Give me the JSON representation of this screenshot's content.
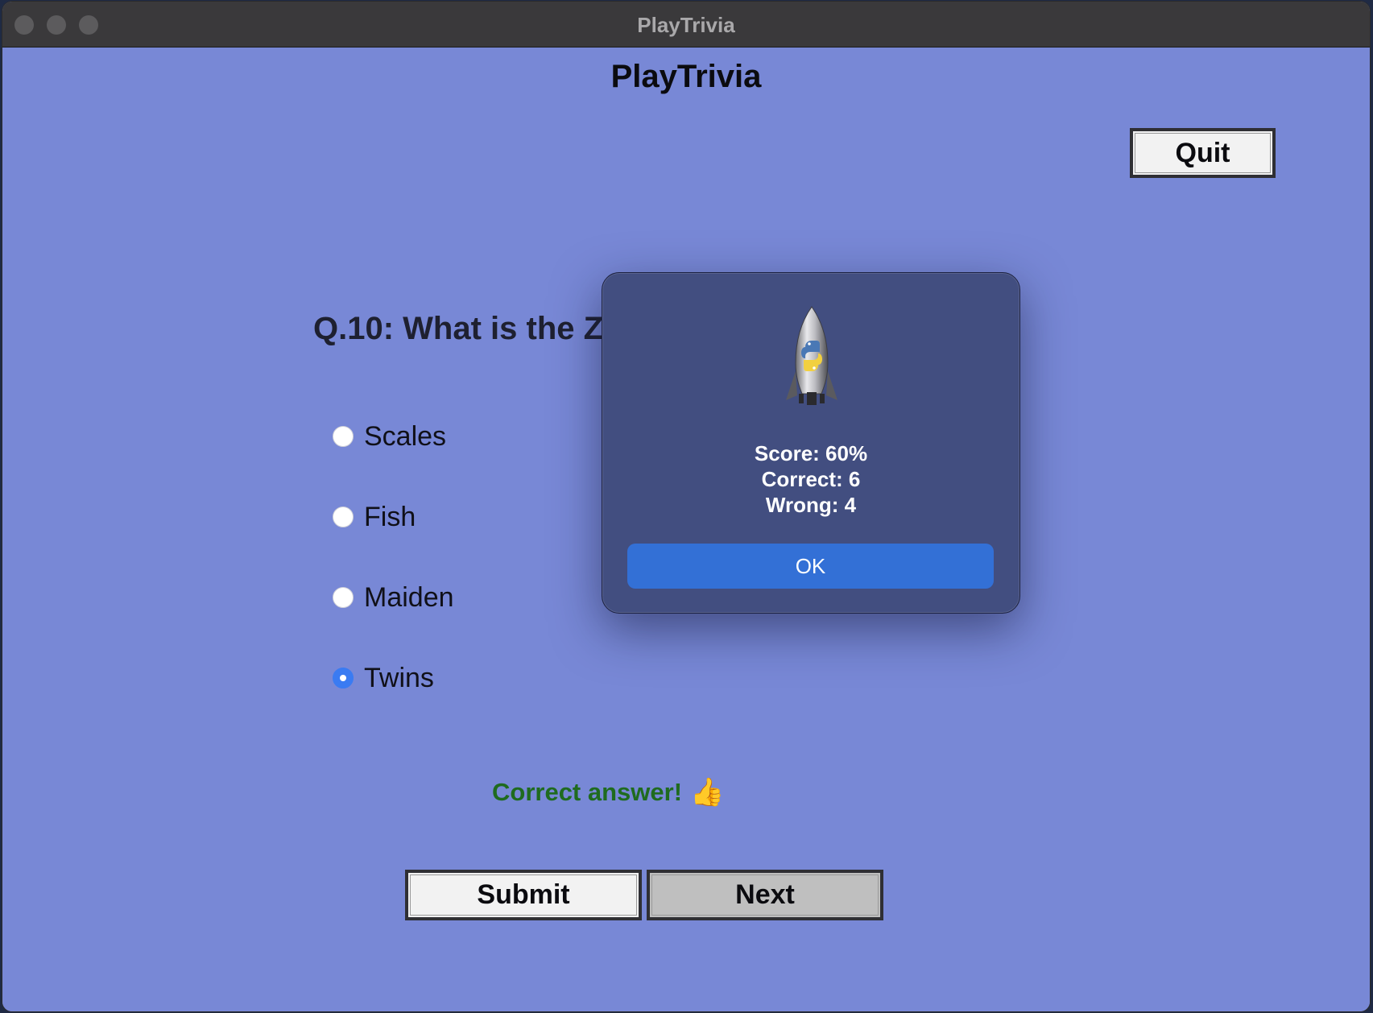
{
  "window": {
    "title": "PlayTrivia"
  },
  "app": {
    "heading": "PlayTrivia",
    "quit_label": "Quit",
    "question": "Q.10: What is the Z",
    "options": [
      {
        "label": "Scales",
        "selected": false
      },
      {
        "label": "Fish",
        "selected": false
      },
      {
        "label": "Maiden",
        "selected": false
      },
      {
        "label": "Twins",
        "selected": true
      }
    ],
    "feedback": "Correct answer!",
    "feedback_icon": "👍",
    "submit_label": "Submit",
    "next_label": "Next"
  },
  "dialog": {
    "icon": "python-rocket-icon",
    "score_line": "Score: 60%",
    "correct_line": "Correct: 6",
    "wrong_line": "Wrong: 4",
    "ok_label": "OK"
  },
  "colors": {
    "background": "#7888d6",
    "titlebar": "#3a393b",
    "dialog": "#424e80",
    "ok_button": "#3370d6",
    "feedback_text": "#1f6b1f",
    "radio_selected": "#3a7bf2"
  }
}
